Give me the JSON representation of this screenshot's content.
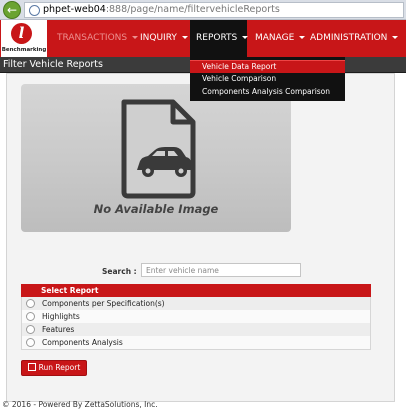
{
  "browser": {
    "url_host": "phpet-web04",
    "url_rest": ":888/page/name/filtervehicleReports"
  },
  "logo": {
    "text": "Benchmarking",
    "letter": "l"
  },
  "nav": {
    "items": [
      {
        "label": "TRANSACTIONS"
      },
      {
        "label": "INQUIRY"
      },
      {
        "label": "REPORTS"
      },
      {
        "label": "MANAGE"
      },
      {
        "label": "ADMINISTRATION"
      }
    ]
  },
  "reports_menu": {
    "items": [
      {
        "label": "Vehicle Data Report"
      },
      {
        "label": "Vehicle Comparison"
      },
      {
        "label": "Components Analysis Comparison"
      }
    ]
  },
  "page": {
    "title": "Filter Vehicle Reports"
  },
  "image_placeholder": {
    "caption": "No Available Image"
  },
  "search": {
    "label": "Search :",
    "placeholder": "Enter vehicle name",
    "value": ""
  },
  "report_table": {
    "header": "Select Report",
    "rows": [
      {
        "label": "Components per Specification(s)"
      },
      {
        "label": "Highlights"
      },
      {
        "label": "Features"
      },
      {
        "label": "Components Analysis"
      }
    ]
  },
  "run_button": {
    "label": "Run Report"
  },
  "footer": {
    "text": "© 2016 - Powered By ZettaSolutions, Inc."
  },
  "colors": {
    "brand_red": "#c81618",
    "dark": "#111111",
    "title_bar": "#3b3b3b"
  }
}
